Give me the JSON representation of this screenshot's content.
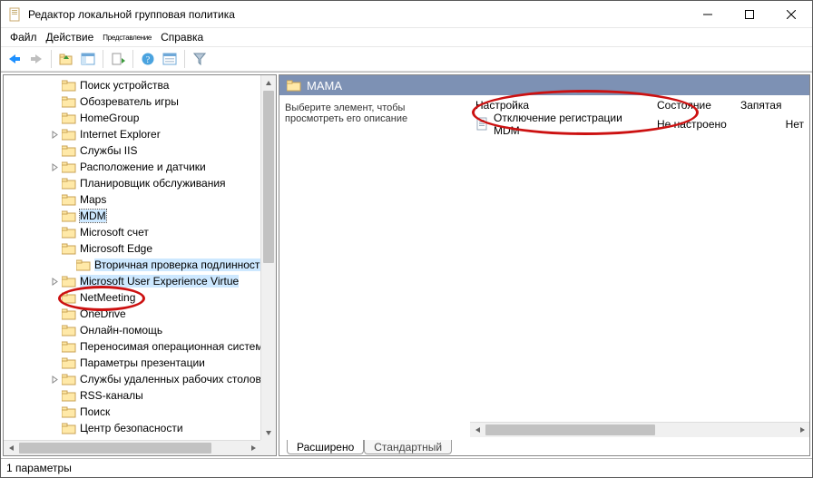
{
  "window": {
    "title": "Редактор локальной групповая политика"
  },
  "menu": {
    "file": "Файл",
    "action": "Действие",
    "view": "Представление",
    "help": "Справка"
  },
  "tree": {
    "items": [
      {
        "label": "Поиск устройства",
        "expander": null,
        "depth": 0
      },
      {
        "label": "Обозреватель игры",
        "expander": null,
        "depth": 0
      },
      {
        "label": "HomeGroup",
        "expander": null,
        "depth": 0
      },
      {
        "label": "Internet Explorer",
        "expander": "closed",
        "depth": 0
      },
      {
        "label": "Службы IIS",
        "expander": null,
        "depth": 0
      },
      {
        "label": "Расположение и датчики",
        "expander": "closed",
        "depth": 0
      },
      {
        "label": "Планировщик обслуживания",
        "expander": null,
        "depth": 0
      },
      {
        "label": "Maps",
        "expander": null,
        "depth": 0
      },
      {
        "label": "MDM",
        "expander": null,
        "depth": 0,
        "selected": true
      },
      {
        "label": "Microsoft счет",
        "expander": null,
        "depth": 0
      },
      {
        "label": "Microsoft Edge",
        "expander": null,
        "depth": 0
      },
      {
        "label": "Вторичная проверка подлинности",
        "expander": null,
        "depth": 1,
        "hl": true
      },
      {
        "label": "Microsoft User Experience Virtue",
        "expander": "closed",
        "depth": 0,
        "hl": true
      },
      {
        "label": "NetMeeting",
        "expander": null,
        "depth": 0
      },
      {
        "label": "OneDrive",
        "expander": null,
        "depth": 0
      },
      {
        "label": "Онлайн-помощь",
        "expander": null,
        "depth": 0
      },
      {
        "label": "Переносимая операционная система",
        "expander": null,
        "depth": 0
      },
      {
        "label": "Параметры презентации",
        "expander": null,
        "depth": 0
      },
      {
        "label": "Службы удаленных рабочих столов",
        "expander": "closed",
        "depth": 0
      },
      {
        "label": "RSS-каналы",
        "expander": null,
        "depth": 0
      },
      {
        "label": "Поиск",
        "expander": null,
        "depth": 0
      },
      {
        "label": "Центр безопасности",
        "expander": null,
        "depth": 0
      }
    ]
  },
  "right": {
    "header": "МАМА",
    "description_hint": "Выберите элемент, чтобы просмотреть его описание",
    "columns": {
      "setting": "Настройка",
      "state": "Состояние",
      "comment": "Запятая"
    },
    "rows": [
      {
        "setting": "Отключение регистрации MDM",
        "state": "Не настроено",
        "comment": "Нет"
      }
    ],
    "tabs": {
      "extended": "Расширено",
      "standard": "Стандартный"
    }
  },
  "status": {
    "text": "1 параметры"
  }
}
